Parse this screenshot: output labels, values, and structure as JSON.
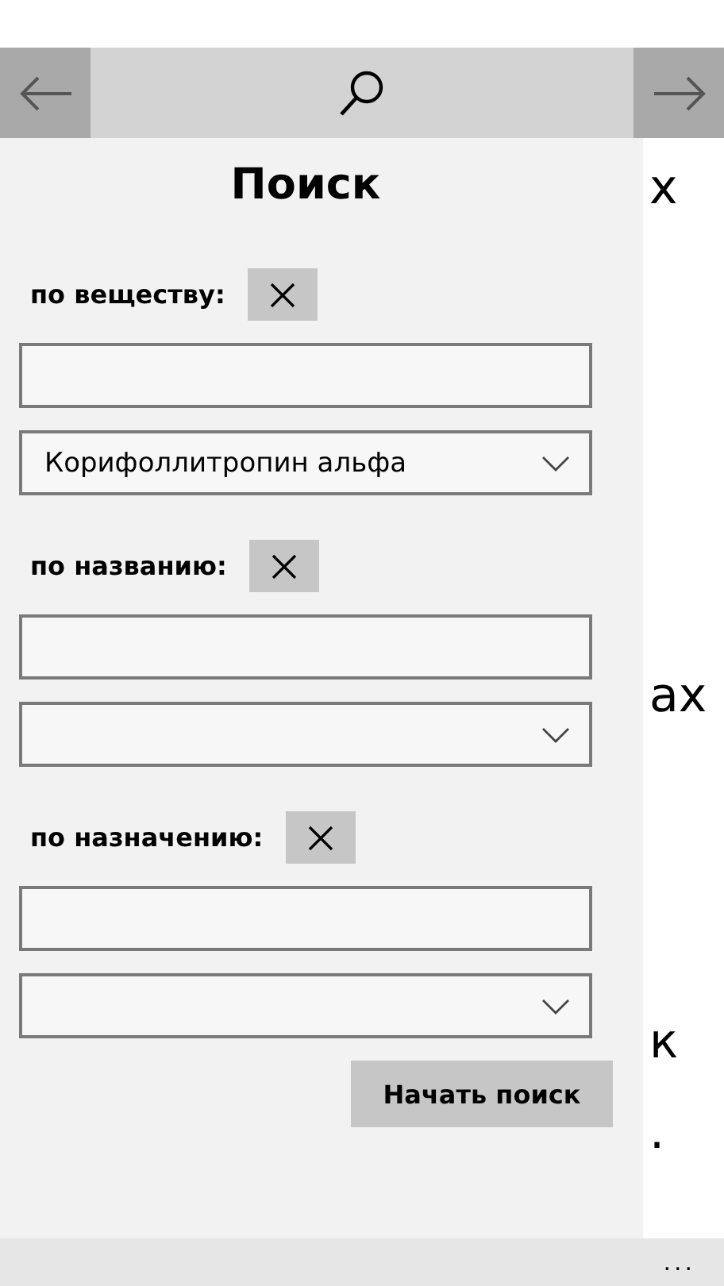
{
  "search_panel": {
    "title": "Поиск",
    "filters": [
      {
        "label": "по веществу:",
        "selection": "Корифоллитропин альфа"
      },
      {
        "label": "по названию:"
      },
      {
        "label": "по назначению:"
      }
    ],
    "start_button": "Начать поиск"
  },
  "background_text": [
    "х",
    "ах",
    "к",
    "."
  ],
  "app_bar": {
    "more": "..."
  }
}
